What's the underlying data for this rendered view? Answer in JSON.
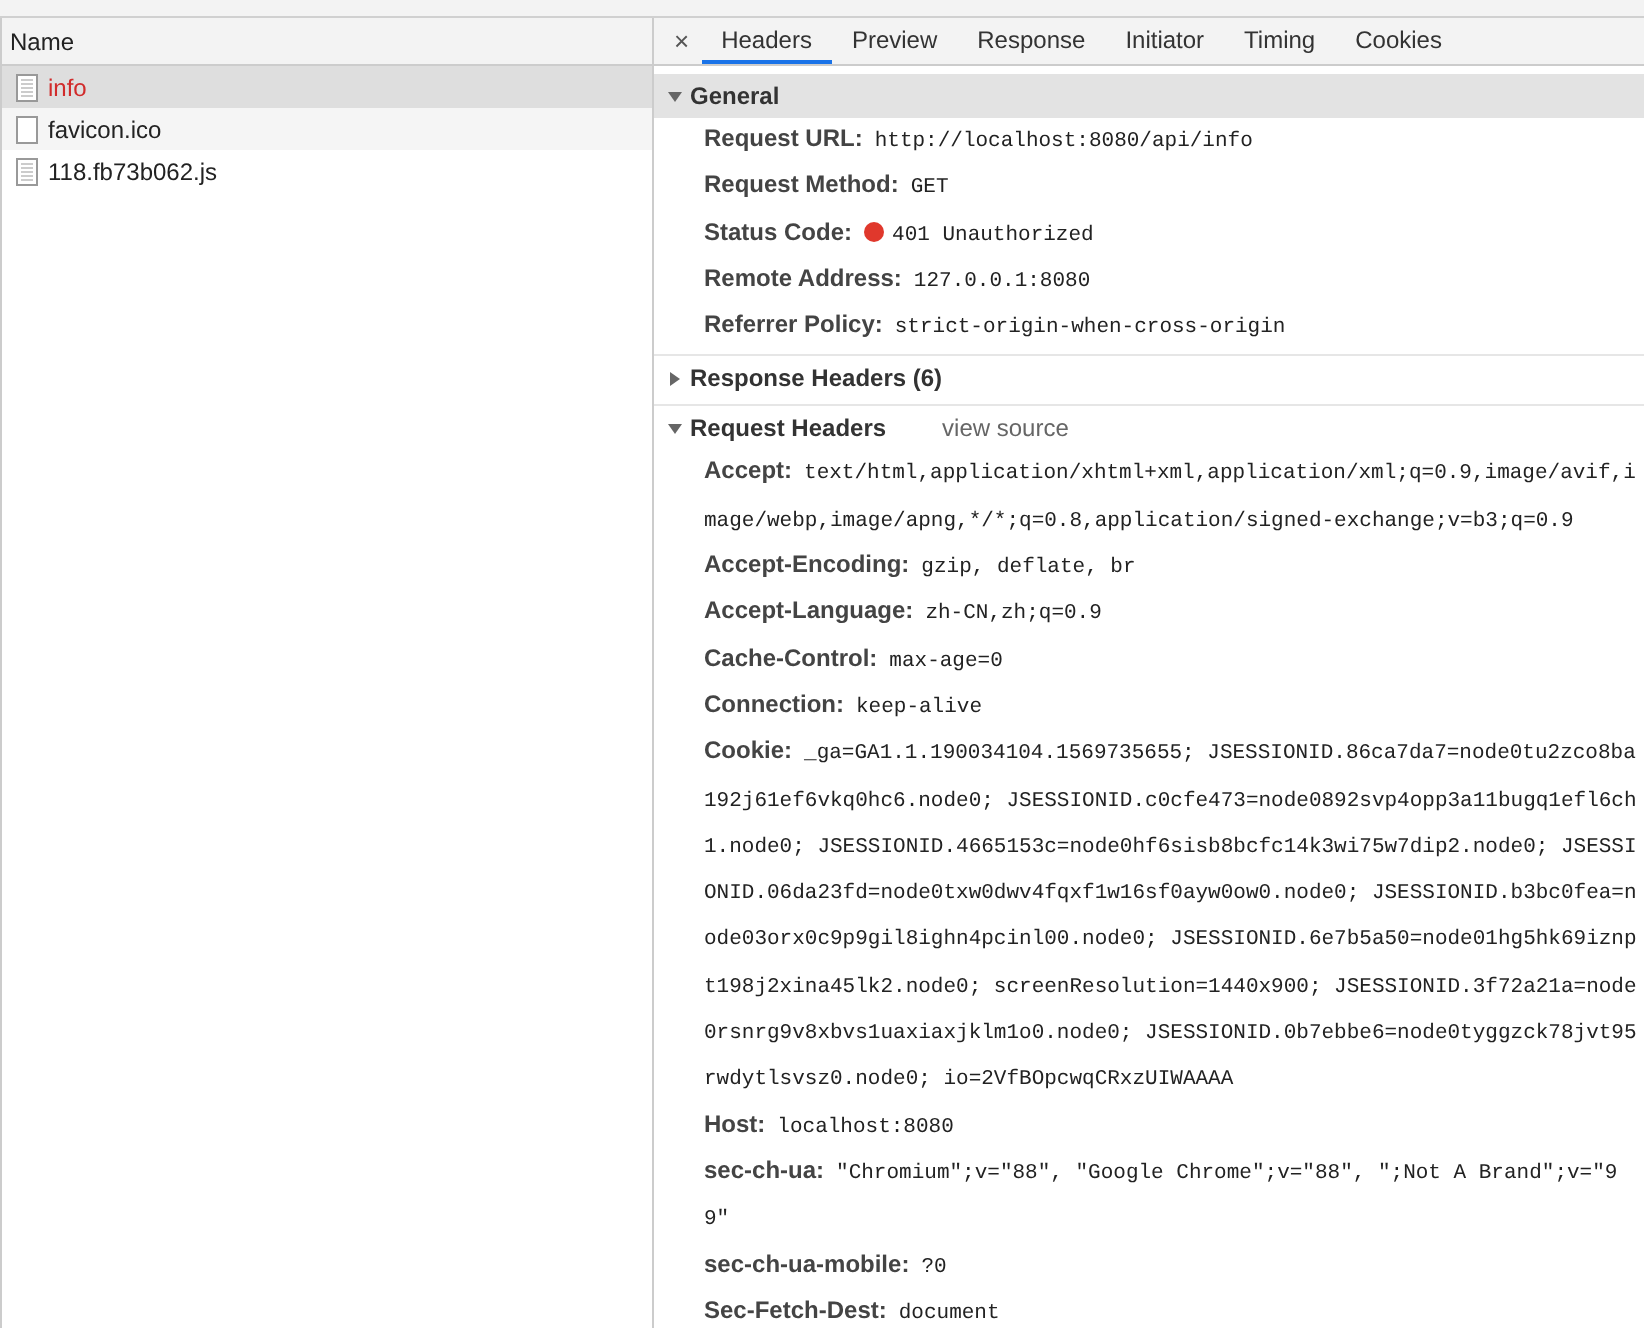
{
  "requests": {
    "column": "Name",
    "rows": [
      {
        "name": "info",
        "kind": "document",
        "selected": true,
        "error": true
      },
      {
        "name": "favicon.ico",
        "kind": "blank",
        "selected": false,
        "error": false
      },
      {
        "name": "118.fb73b062.js",
        "kind": "document",
        "selected": false,
        "error": false
      }
    ]
  },
  "details": {
    "close": "×",
    "tabs": [
      {
        "label": "Headers",
        "selected": true
      },
      {
        "label": "Preview",
        "selected": false
      },
      {
        "label": "Response",
        "selected": false
      },
      {
        "label": "Initiator",
        "selected": false
      },
      {
        "label": "Timing",
        "selected": false
      },
      {
        "label": "Cookies",
        "selected": false
      }
    ],
    "sections": [
      {
        "title": "General",
        "expanded": true,
        "shaded": true,
        "items": [
          {
            "name": "Request URL:",
            "value": "http://localhost:8080/api/info"
          },
          {
            "name": "Request Method:",
            "value": "GET"
          },
          {
            "name": "Status Code:",
            "value": "401 Unauthorized",
            "color": "#e0382c"
          },
          {
            "name": "Remote Address:",
            "value": "127.0.0.1:8080"
          },
          {
            "name": "Referrer Policy:",
            "value": "strict-origin-when-cross-origin"
          }
        ]
      },
      {
        "title": "Response Headers (6)",
        "expanded": false,
        "shaded": false
      },
      {
        "title": "Request Headers",
        "link": "view source",
        "expanded": true,
        "shaded": false,
        "items": [
          {
            "name": "Accept:",
            "value": "text/html,application/xhtml+xml,application/xml;q=0.9,image/avif,image/webp,image/apng,*/*;q=0.8,application/signed-exchange;v=b3;q=0.9"
          },
          {
            "name": "Accept-Encoding:",
            "value": "gzip, deflate, br"
          },
          {
            "name": "Accept-Language:",
            "value": "zh-CN,zh;q=0.9"
          },
          {
            "name": "Cache-Control:",
            "value": "max-age=0"
          },
          {
            "name": "Connection:",
            "value": "keep-alive"
          },
          {
            "name": "Cookie:",
            "value": "_ga=GA1.1.190034104.1569735655; JSESSIONID.86ca7da7=node0tu2zco8ba192j61ef6vkq0hc6.node0; JSESSIONID.c0cfe473=node0892svp4opp3a11bugq1efl6ch1.node0; JSESSIONID.4665153c=node0hf6sisb8bcfc14k3wi75w7dip2.node0; JSESSIONID.06da23fd=node0txw0dwv4fqxf1w16sf0ayw0ow0.node0; JSESSIONID.b3bc0fea=node03orx0c9p9gil8ighn4pcinl00.node0; JSESSIONID.6e7b5a50=node01hg5hk69iznpt198j2xina45lk2.node0; screenResolution=1440x900; JSESSIONID.3f72a21a=node0rsnrg9v8xbvs1uaxiaxjklm1o0.node0; JSESSIONID.0b7ebbe6=node0tyggzck78jvt95rwdytlsvsz0.node0; io=2VfBOpcwqCRxzUIWAAAA"
          },
          {
            "name": "Host:",
            "value": "localhost:8080"
          },
          {
            "name": "sec-ch-ua:",
            "value": "\"Chromium\";v=\"88\", \"Google Chrome\";v=\"88\", \";Not A Brand\";v=\"99\""
          },
          {
            "name": "sec-ch-ua-mobile:",
            "value": "?0"
          },
          {
            "name": "Sec-Fetch-Dest:",
            "value": "document"
          }
        ]
      }
    ]
  }
}
